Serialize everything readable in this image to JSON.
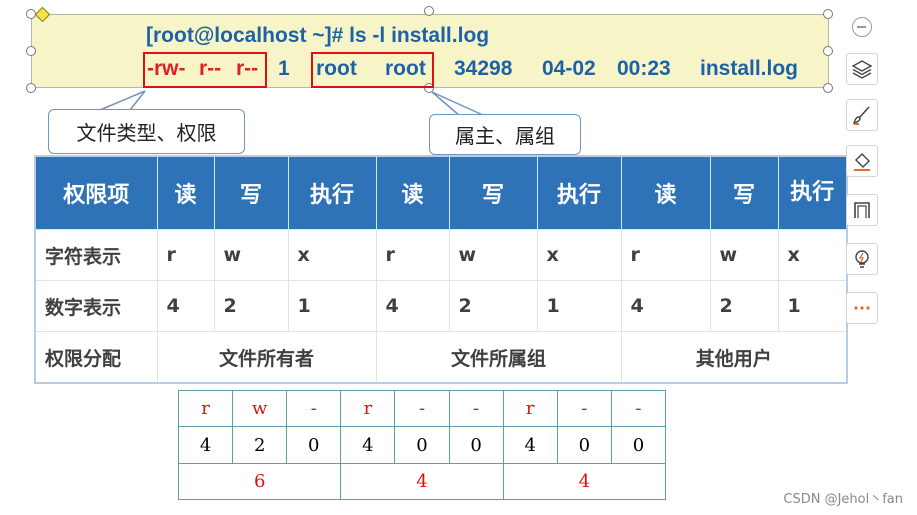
{
  "terminal": {
    "command": "[root@localhost ~]# ls -l install.log",
    "perm_user": "-rw-",
    "perm_group": "r--",
    "perm_other": "r--",
    "links": "1",
    "owner": "root",
    "group": "root",
    "size": "34298",
    "date": "04-02",
    "time": "00:23",
    "filename": "install.log"
  },
  "callouts": {
    "type_perm": "文件类型、权限",
    "owner_group": "属主、属组"
  },
  "perm_table": {
    "headers": [
      "权限项",
      "读",
      "写",
      "执行",
      "读",
      "写",
      "执行",
      "读",
      "写",
      "执行"
    ],
    "char_row": [
      "字符表示",
      "r",
      "w",
      "x",
      "r",
      "w",
      "x",
      "r",
      "w",
      "x"
    ],
    "num_row": [
      "数字表示",
      "4",
      "2",
      "1",
      "4",
      "2",
      "1",
      "4",
      "2",
      "1"
    ],
    "assign_row": [
      "权限分配",
      "文件所有者",
      "文件所属组",
      "其他用户"
    ]
  },
  "bit_table": {
    "chars": [
      "r",
      "w",
      "-",
      "r",
      "-",
      "-",
      "r",
      "-",
      "-"
    ],
    "nums": [
      "4",
      "2",
      "0",
      "4",
      "0",
      "0",
      "4",
      "0",
      "0"
    ],
    "totals": [
      "6",
      "4",
      "4"
    ]
  },
  "toolbar": {
    "icons": [
      "layers-icon",
      "brush-icon",
      "fill-icon",
      "frame-icon",
      "bulb-icon",
      "more-icon"
    ],
    "accent": "#e8692b"
  },
  "watermark": "CSDN @Jehol丶fan"
}
